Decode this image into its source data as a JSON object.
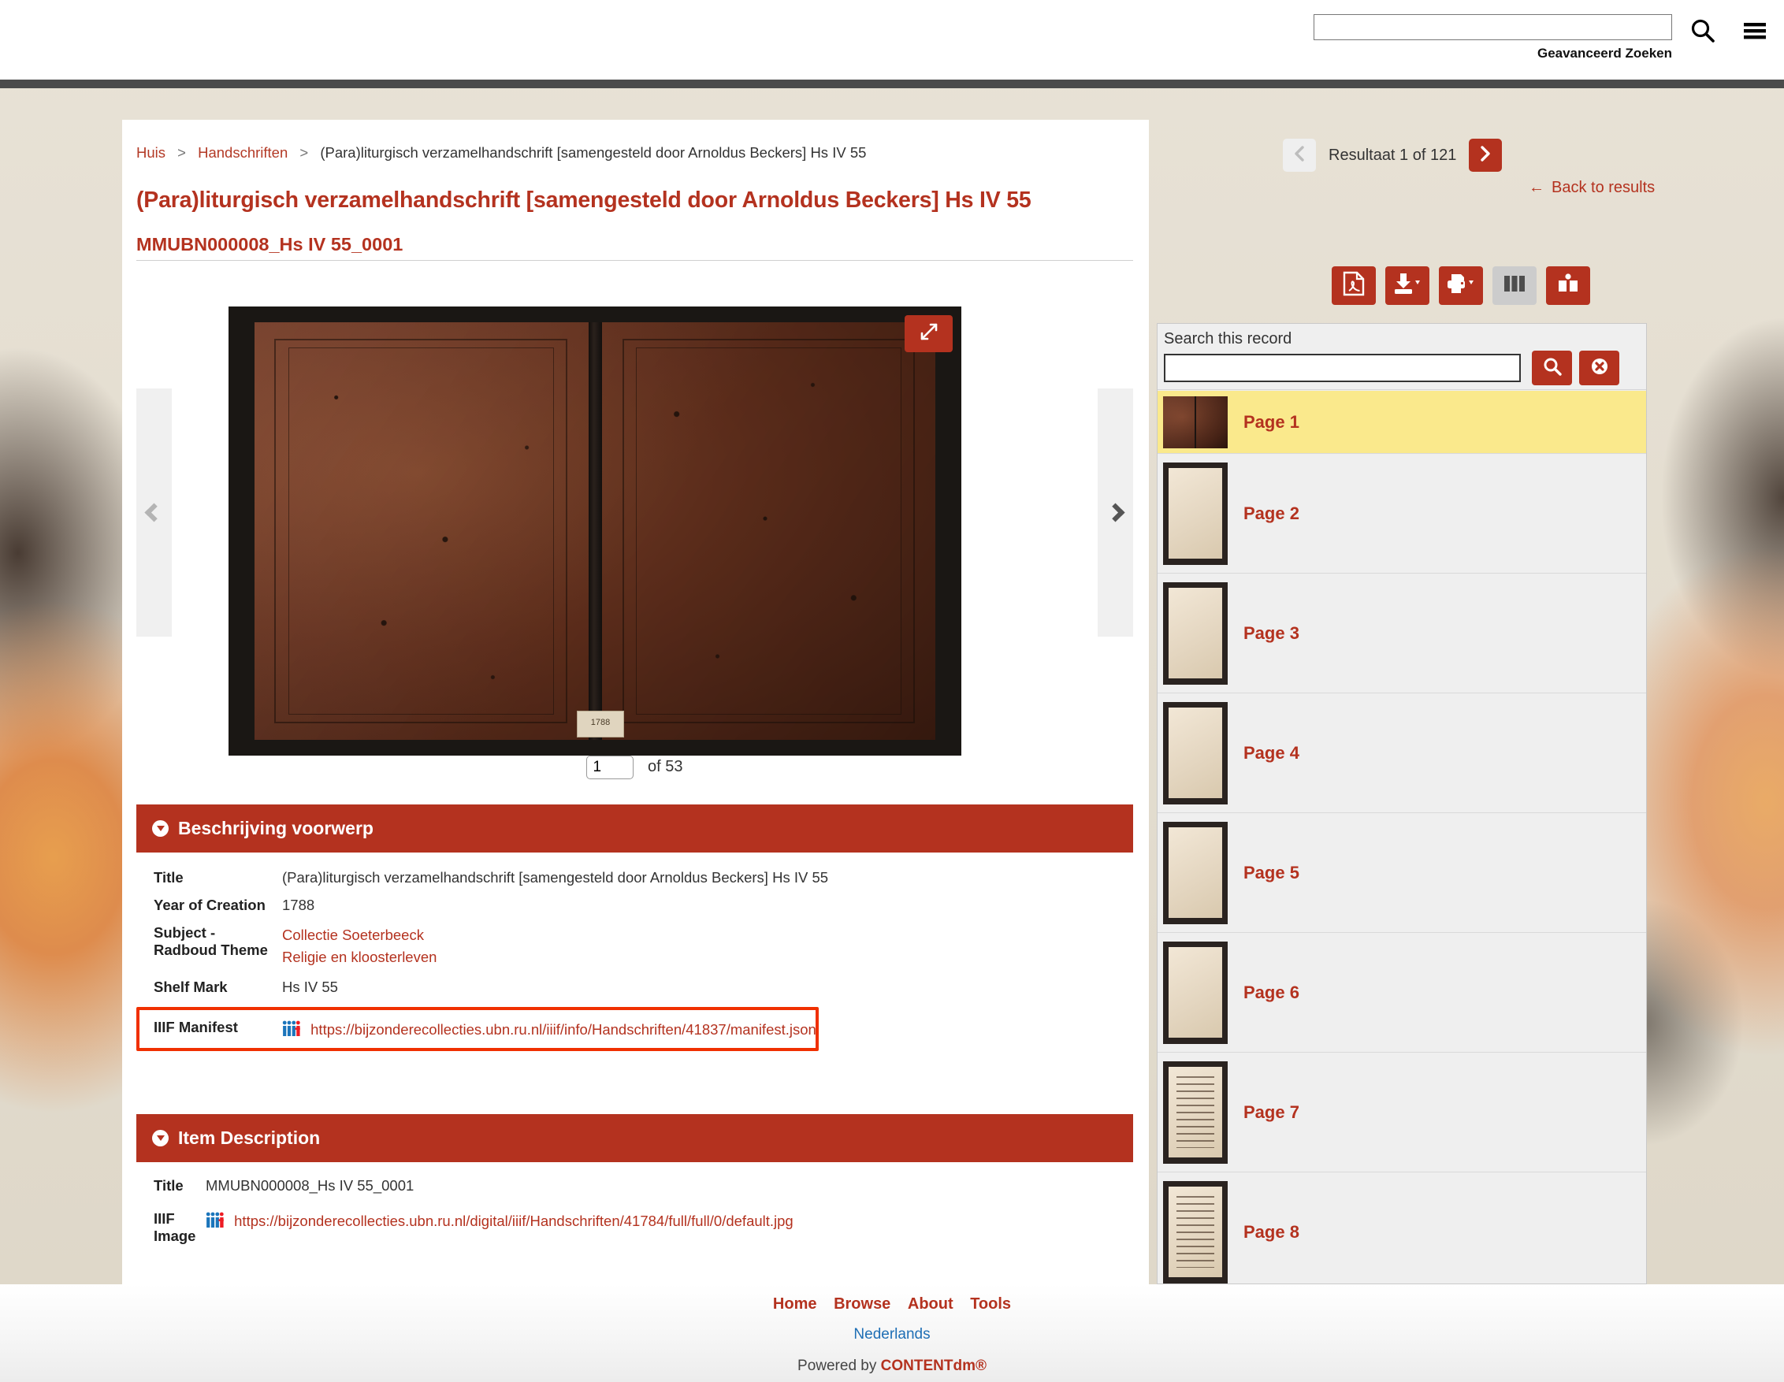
{
  "header": {
    "search_value": "",
    "search_placeholder": "",
    "advanced_search": "Geavanceerd Zoeken",
    "search_icon": "search-icon",
    "menu_icon": "hamburger-menu-icon"
  },
  "breadcrumb": {
    "home": "Huis",
    "collection": "Handschriften",
    "current": "(Para)liturgisch verzamelhandschrift [samengesteld door Arnoldus Beckers] Hs IV 55",
    "separator": ">"
  },
  "record": {
    "title": "(Para)liturgisch verzamelhandschrift [samengesteld door Arnoldus Beckers] Hs IV 55",
    "subtitle": "MMUBN000008_Hs IV 55_0001"
  },
  "result_nav": {
    "prev_icon": "chevron-left-icon",
    "next_icon": "chevron-right-icon",
    "label": "Resultaat 1 of 121",
    "back_to_results": "Back to results",
    "back_arrow": "←"
  },
  "viewer": {
    "prev_page_icon": "chevron-left-icon",
    "next_page_icon": "chevron-right-icon",
    "fullscreen_icon": "expand-fullscreen-icon",
    "cover_label": "1788",
    "page_value": "1",
    "page_total": "of 53"
  },
  "toolbar": {
    "buttons": [
      {
        "name": "pdf-button",
        "icon": "pdf-file-icon"
      },
      {
        "name": "download-button",
        "icon": "download-icon"
      },
      {
        "name": "print-button",
        "icon": "printer-icon"
      },
      {
        "name": "compare-view-button",
        "icon": "columns-view-icon"
      },
      {
        "name": "reader-view-button",
        "icon": "open-book-icon"
      }
    ]
  },
  "record_search": {
    "label": "Search this record",
    "input_value": "",
    "input_placeholder": "",
    "go_icon": "search-icon",
    "clear_icon": "clear-circle-x-icon"
  },
  "pages": [
    {
      "label": "Page 1",
      "kind": "cover",
      "active": true
    },
    {
      "label": "Page 2",
      "kind": "blank",
      "active": false
    },
    {
      "label": "Page 3",
      "kind": "blank",
      "active": false
    },
    {
      "label": "Page 4",
      "kind": "blank",
      "active": false
    },
    {
      "label": "Page 5",
      "kind": "blank",
      "active": false
    },
    {
      "label": "Page 6",
      "kind": "blank",
      "active": false
    },
    {
      "label": "Page 7",
      "kind": "music",
      "active": false
    },
    {
      "label": "Page 8",
      "kind": "music",
      "active": false
    }
  ],
  "object_description": {
    "heading": "Beschrijving voorwerp",
    "rows": [
      {
        "label": "Title",
        "value": "(Para)liturgisch verzamelhandschrift [samengesteld door Arnoldus Beckers] Hs IV 55",
        "type": "text"
      },
      {
        "label": "Year of Creation",
        "value": "1788",
        "type": "text"
      },
      {
        "label": "Subject - Radboud Theme",
        "links": [
          "Collectie Soeterbeeck",
          "Religie en kloosterleven"
        ],
        "type": "links"
      },
      {
        "label": "Shelf Mark",
        "value": "Hs IV 55",
        "type": "text"
      },
      {
        "label": "IIIF Manifest",
        "value": "https://bijzonderecollecties.ubn.ru.nl/iiif/info/Handschriften/41837/manifest.json",
        "type": "iiif-link",
        "highlighted": true
      }
    ]
  },
  "item_description": {
    "heading": "Item Description",
    "rows": [
      {
        "label": "Title",
        "value": "MMUBN000008_Hs IV 55_0001",
        "type": "text"
      },
      {
        "label": "IIIF Image",
        "value": "https://bijzonderecollecties.ubn.ru.nl/digital/iiif/Handschriften/41784/full/full/0/default.jpg",
        "type": "iiif-link"
      }
    ]
  },
  "footer": {
    "links": [
      "Home",
      "Browse",
      "About",
      "Tools"
    ],
    "language": "Nederlands",
    "powered_prefix": "Powered by ",
    "powered_brand": "CONTENTdm®"
  },
  "colors": {
    "accent": "#b4321f",
    "highlight_box": "#f03000",
    "active_page": "#fae98c",
    "panel_bg": "#efefef",
    "link_blue": "#1f6fb5"
  }
}
